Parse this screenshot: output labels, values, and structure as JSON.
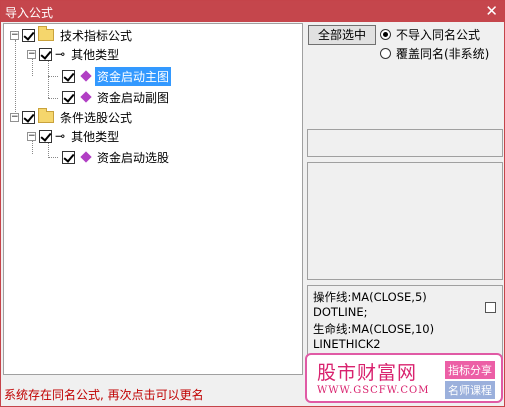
{
  "window": {
    "title": "导入公式",
    "close_glyph": "✕"
  },
  "tree": {
    "group1": {
      "label": "技术指标公式",
      "toggle": "−"
    },
    "group1_sub": {
      "label": "其他类型",
      "toggle": "−"
    },
    "group1_items": [
      {
        "label": "资金启动主图"
      },
      {
        "label": "资金启动副图"
      }
    ],
    "group2": {
      "label": "条件选股公式",
      "toggle": "−"
    },
    "group2_sub": {
      "label": "其他类型",
      "toggle": "−"
    },
    "group2_items": [
      {
        "label": "资金启动选股"
      }
    ]
  },
  "controls": {
    "select_all_label": "全部选中",
    "radio_skip_label": "不导入同名公式",
    "radio_overwrite_label": "覆盖同名(非系统)"
  },
  "code_lines": [
    "操作线:MA(CLOSE,5)",
    "DOTLINE;",
    "生命线:MA(CLOSE,10)",
    "LINETHICK2"
  ],
  "status_text": "系统存在同名公式, 再次点击可以更名",
  "watermark": {
    "name_cn": "股市财富网",
    "url": "WWW.GSCFW.COM",
    "tag1": "指标分享",
    "tag2": "名师课程"
  }
}
